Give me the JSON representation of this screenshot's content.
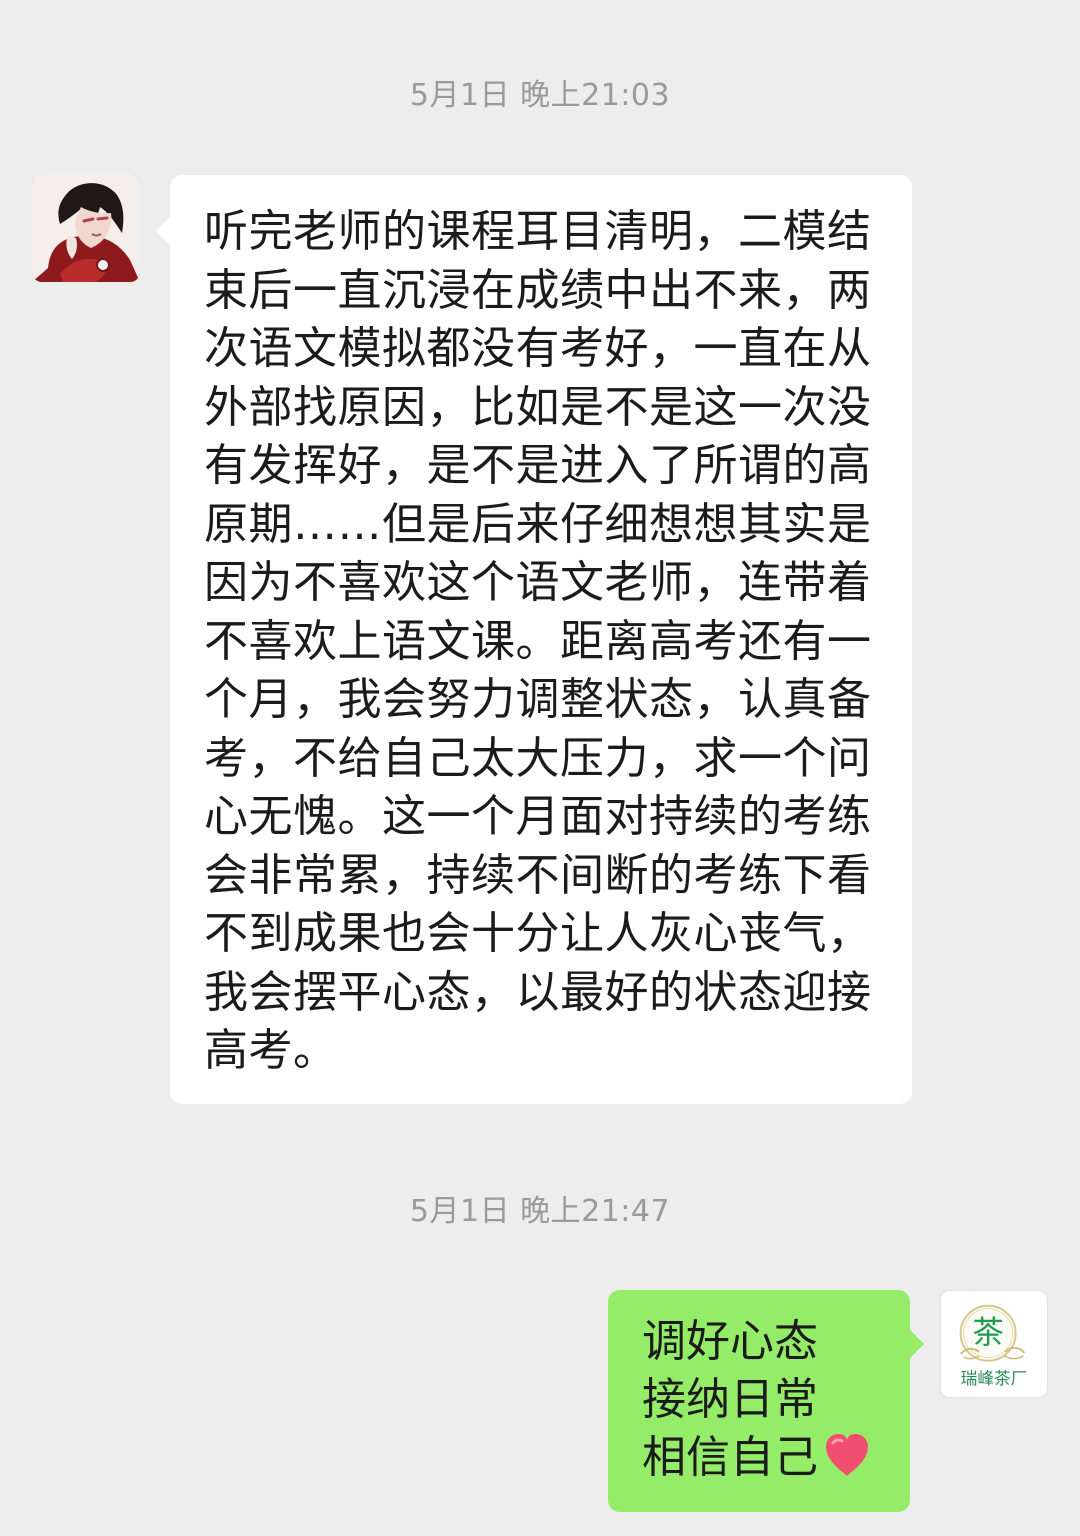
{
  "chat": {
    "messages": [
      {
        "timestamp": "5月1日 晚上21:03",
        "sender": "other",
        "text": "听完老师的课程耳目清明，二模结束后一直沉浸在成绩中出不来，两次语文模拟都没有考好，一直在从外部找原因，比如是不是这一次没有发挥好，是不是进入了所谓的高原期……但是后来仔细想想其实是因为不喜欢这个语文老师，连带着不喜欢上语文课。距离高考还有一个月，我会努力调整状态，认真备考，不给自己太大压力，求一个问心无愧。这一个月面对持续的考练会非常累，持续不间断的考练下看不到成果也会十分让人灰心丧气，我会摆平心态，以最好的状态迎接高考。"
      },
      {
        "timestamp": "5月1日 晚上21:47",
        "sender": "self",
        "lines": [
          "调好心态",
          "接纳日常",
          "相信自己"
        ],
        "emoji": "heart-icon"
      }
    ]
  },
  "self_avatar": {
    "logo_char": "茶",
    "brand": "瑞峰茶厂"
  },
  "colors": {
    "background": "#ededed",
    "other_bubble": "#ffffff",
    "self_bubble": "#95ec69",
    "timestamp": "#9a9a9a",
    "text": "#1b1b1b"
  }
}
